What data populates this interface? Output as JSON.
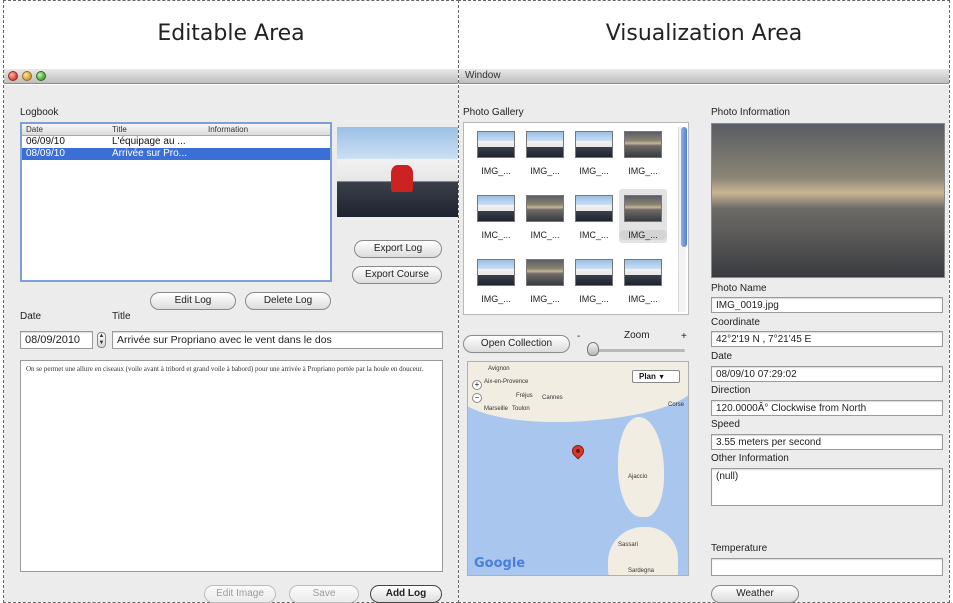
{
  "left": {
    "heading": "Editable Area",
    "logbook_label": "Logbook",
    "table": {
      "columns": [
        "Date",
        "Title",
        "Information"
      ],
      "rows": [
        {
          "date": "06/09/10",
          "title": "L'équipage au ...",
          "info": ""
        },
        {
          "date": "08/09/10",
          "title": "Arrivée sur Pro...",
          "info": ""
        }
      ]
    },
    "export_log": "Export Log",
    "export_course": "Export Course",
    "edit_log": "Edit Log",
    "delete_log": "Delete Log",
    "date_label": "Date",
    "title_label": "Title",
    "date_value": "08/09/2010",
    "title_value": "Arrivée sur Propriano avec le vent dans le dos",
    "description": "On se permet une allure en ciseaux (voile avant à tribord et grand voile à babord) pour une arrivée à Propriano portée par la houle en douceur.",
    "edit_image": "Edit Image",
    "save": "Save",
    "add_log": "Add Log"
  },
  "right": {
    "heading": "Visualization Area",
    "window_title": "Window",
    "photo_gallery_label": "Photo Gallery",
    "photo_info_label": "Photo Information",
    "thumbs": [
      "IMG_...",
      "IMG_...",
      "IMG_...",
      "IMG_...",
      "IMC_...",
      "IMC_...",
      "IMC_...",
      "IMG_...",
      "IMG_...",
      "IMG_...",
      "IMG_...",
      "IMG_..."
    ],
    "open_collection": "Open Collection",
    "zoom_label": "Zoom",
    "zoom_minus": "-",
    "zoom_plus": "+",
    "map": {
      "plan_select": "Plan",
      "labels": [
        "Avignon",
        "Aix-en-Provence",
        "Marseille",
        "Toulon",
        "Fréjus",
        "Cannes",
        "Ajaccio",
        "Sassari",
        "Sardegna",
        "Corse"
      ],
      "logo": "Google"
    },
    "photo_name_label": "Photo Name",
    "photo_name": "IMG_0019.jpg",
    "coordinate_label": "Coordinate",
    "coordinate": "42°2'19 N , 7°21'45 E",
    "date_label": "Date",
    "date": "08/09/10 07:29:02",
    "direction_label": "Direction",
    "direction": "120.0000Â° Clockwise from North",
    "speed_label": "Speed",
    "speed": "3.55 meters per second",
    "other_label": "Other Information",
    "other": "(null)",
    "temperature_label": "Temperature",
    "temperature": "",
    "weather": "Weather"
  }
}
